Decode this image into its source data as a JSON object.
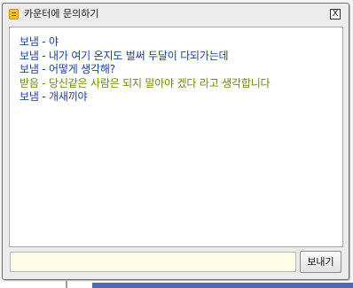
{
  "window": {
    "title": "카운터에 문의하기",
    "close_label": "X"
  },
  "chat": {
    "messages": [
      {
        "text": "보냄 - 야",
        "color": "#1f3f8f"
      },
      {
        "text": "보냄 - 내가 여기 온지도 벌써 두달이 다되가는데",
        "color": "#1f3f8f"
      },
      {
        "text": "보냄 - 어떻게 생각해?",
        "color": "#1f3f8f"
      },
      {
        "text": "받음 - 당신같은 사람은 되지 말아야 겠다 라고 생각합니다",
        "color": "#6b8e00"
      },
      {
        "text": "보냄 - 개새끼야",
        "color": "#1f3f8f"
      }
    ]
  },
  "input": {
    "value": "",
    "placeholder": ""
  },
  "send_button": {
    "label": "보내기"
  },
  "colors": {
    "sent": "#1f3f8f",
    "received": "#6b8e00",
    "input_background": "#fffde8"
  }
}
